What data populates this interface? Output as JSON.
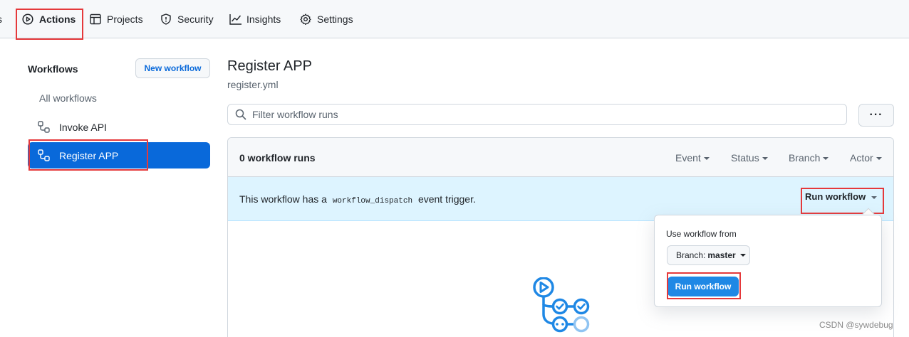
{
  "nav": {
    "prev_tab_fragment": "s",
    "tabs": [
      {
        "label": "Actions",
        "icon": "play-circle-icon"
      },
      {
        "label": "Projects",
        "icon": "table-icon"
      },
      {
        "label": "Security",
        "icon": "shield-icon"
      },
      {
        "label": "Insights",
        "icon": "graph-icon"
      },
      {
        "label": "Settings",
        "icon": "gear-icon"
      }
    ]
  },
  "sidebar": {
    "title": "Workflows",
    "new_workflow_label": "New workflow",
    "items": [
      {
        "label": "All workflows"
      },
      {
        "label": "Invoke API",
        "icon": "workflow-icon"
      },
      {
        "label": "Register APP",
        "icon": "workflow-icon",
        "selected": true
      }
    ]
  },
  "main": {
    "title": "Register APP",
    "subtitle": "register.yml",
    "filter_placeholder": "Filter workflow runs",
    "more_label": "···",
    "runs_count": "0 workflow runs",
    "filters": [
      "Event",
      "Status",
      "Branch",
      "Actor"
    ],
    "banner": {
      "text_before": "This workflow has a",
      "code": "workflow_dispatch",
      "text_after": "event trigger.",
      "run_dropdown_label": "Run workflow"
    }
  },
  "popover": {
    "label": "Use workflow from",
    "branch_prefix": "Branch:",
    "branch_name": "master",
    "run_button_label": "Run workflow"
  },
  "watermark": "CSDN @sywdebug",
  "colors": {
    "accent": "#0969da",
    "highlight_box": "#e5393b",
    "banner_bg": "#ddf4ff",
    "run_button": "#1f88e5"
  }
}
